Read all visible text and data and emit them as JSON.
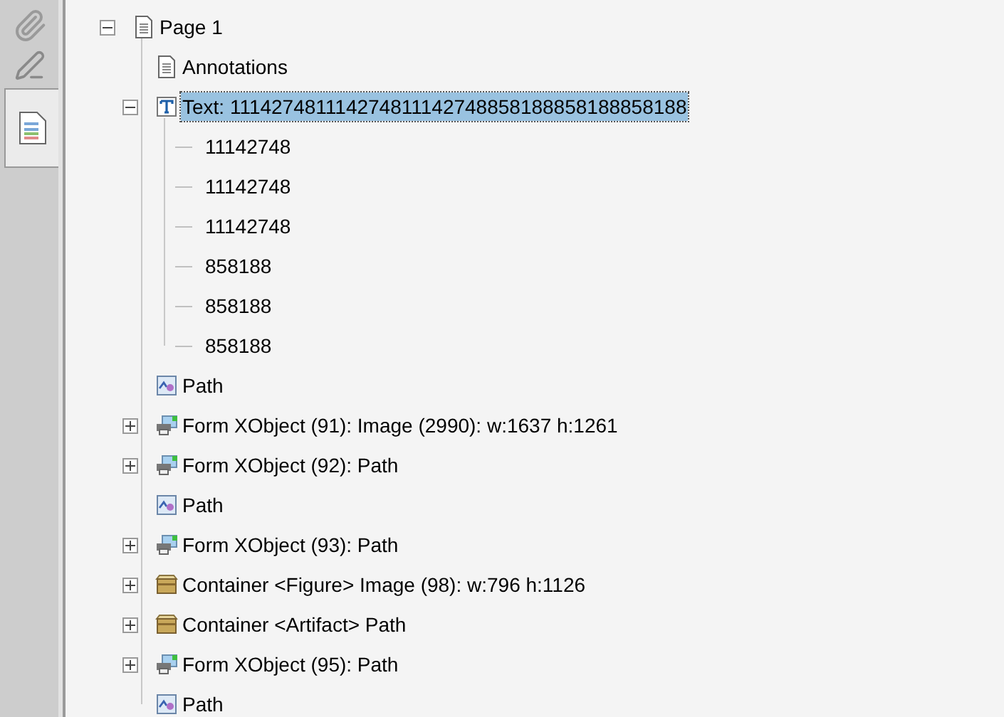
{
  "sidebar": {
    "tabs": [
      {
        "kind": "attachments",
        "selected": false
      },
      {
        "kind": "signatures",
        "selected": false
      },
      {
        "kind": "content",
        "selected": true
      }
    ]
  },
  "tree": [
    {
      "label": "Page 1",
      "kind": "page",
      "expanded": true,
      "selected": false,
      "children": [
        {
          "label": "Annotations",
          "kind": "page",
          "selected": false
        },
        {
          "label": "Text: 111427481114274811142748858188858188858188",
          "kind": "text",
          "expanded": true,
          "selected": true,
          "children": [
            {
              "label": "11142748",
              "kind": "value",
              "selected": false
            },
            {
              "label": "11142748",
              "kind": "value",
              "selected": false
            },
            {
              "label": "11142748",
              "kind": "value",
              "selected": false
            },
            {
              "label": "858188",
              "kind": "value",
              "selected": false
            },
            {
              "label": "858188",
              "kind": "value",
              "selected": false
            },
            {
              "label": "858188",
              "kind": "value",
              "selected": false
            }
          ]
        },
        {
          "label": "Path",
          "kind": "path",
          "selected": false
        },
        {
          "label": "Form XObject (91): Image (2990): w:1637 h:1261",
          "kind": "form",
          "expanded": false,
          "selected": false
        },
        {
          "label": "Form XObject (92): Path",
          "kind": "form",
          "expanded": false,
          "selected": false
        },
        {
          "label": "Path",
          "kind": "path",
          "selected": false
        },
        {
          "label": "Form XObject (93): Path",
          "kind": "form",
          "expanded": false,
          "selected": false
        },
        {
          "label": "Container <Figure> Image (98): w:796 h:1126",
          "kind": "container",
          "expanded": false,
          "selected": false
        },
        {
          "label": "Container <Artifact> Path",
          "kind": "container",
          "expanded": false,
          "selected": false
        },
        {
          "label": "Form XObject (95): Path",
          "kind": "form",
          "expanded": false,
          "selected": false
        },
        {
          "label": "Path",
          "kind": "path",
          "selected": false
        }
      ]
    }
  ]
}
